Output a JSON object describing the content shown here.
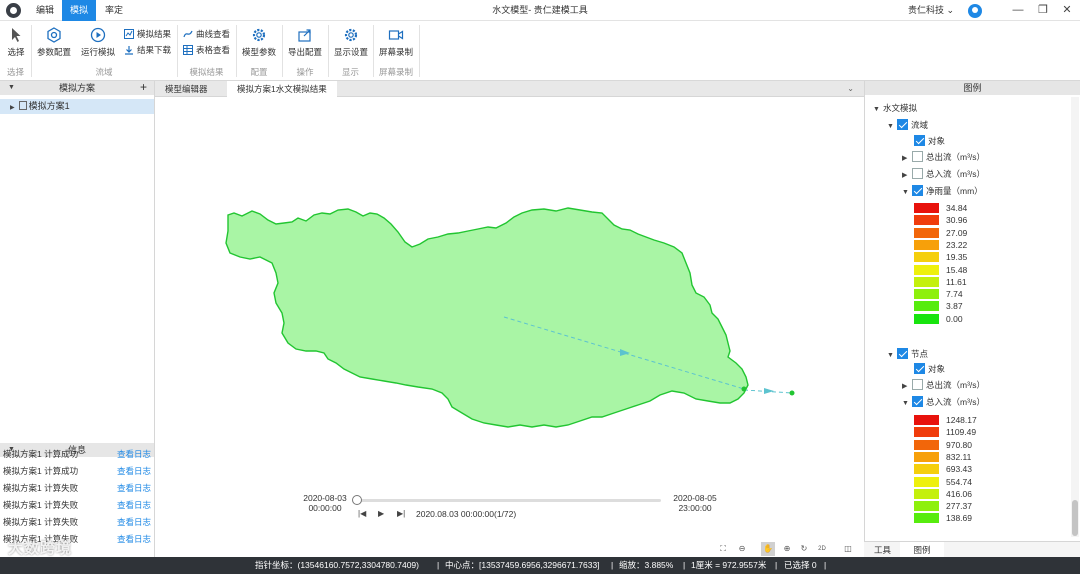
{
  "titlebar": {
    "menu_edit": "编辑",
    "menu_simulate": "模拟",
    "menu_calibrate": "率定",
    "window_title": "水文模型- 贵仁建模工具",
    "company": "贵仁科技 ⌄",
    "accent_color": "#1e88e5"
  },
  "ribbon": {
    "select": "选择",
    "param_config": "参数配置",
    "run_sim": "运行模拟",
    "sim_result": "模拟结果",
    "result_download": "结果下载",
    "curve_view": "曲线查看",
    "table_view": "表格查看",
    "model_params": "模型参数",
    "export_config": "导出配置",
    "display_settings": "显示设置",
    "screen_record": "屏幕录制",
    "groups": {
      "select": "选择",
      "basin": "流域",
      "sim_result": "模拟结果",
      "config": "配置",
      "operation": "操作",
      "display": "显示",
      "screen_record": "屏幕录制"
    }
  },
  "left_panel": {
    "header": "模拟方案",
    "add_icon": "+",
    "tree_item": "模拟方案1",
    "info_header": "信息",
    "info_rows": [
      {
        "msg": "模拟方案1 计算成功",
        "link": "查看日志"
      },
      {
        "msg": "模拟方案1 计算成功",
        "link": "查看日志"
      },
      {
        "msg": "模拟方案1 计算失败",
        "link": "查看日志"
      },
      {
        "msg": "模拟方案1 计算失败",
        "link": "查看日志"
      },
      {
        "msg": "模拟方案1 计算失败",
        "link": "查看日志"
      },
      {
        "msg": "模拟方案1 计算失败",
        "link": "查看日志"
      }
    ]
  },
  "tabs": {
    "tab1": "模型编辑器",
    "tab2": "模拟方案1水文模拟结果"
  },
  "timeline": {
    "start_date": "2020-08-03",
    "start_time": "00:00:00",
    "end_date": "2020-08-05",
    "end_time": "23:00:00",
    "current": "2020.08.03 00:00:00(1/72)",
    "progress": 0
  },
  "map_tools": {
    "mode_2d": "2D"
  },
  "legend_panel": {
    "header": "图例",
    "root": "水文模拟",
    "basin": "流域",
    "object": "对象",
    "total_outflow": "总出流（m³/s）",
    "total_inflow": "总入流（m³/s）",
    "net_rain": "净雨量（mm）",
    "rain_classes": [
      {
        "label": "34.84",
        "color": "#e8120c"
      },
      {
        "label": "30.96",
        "color": "#f03c0c"
      },
      {
        "label": "27.09",
        "color": "#f2660a"
      },
      {
        "label": "23.22",
        "color": "#f7a00a"
      },
      {
        "label": "19.35",
        "color": "#f5cf0c"
      },
      {
        "label": "15.48",
        "color": "#eef00c"
      },
      {
        "label": "11.61",
        "color": "#c4f00c"
      },
      {
        "label": "7.74",
        "color": "#8ef00c"
      },
      {
        "label": "3.87",
        "color": "#57ec0e"
      },
      {
        "label": "0.00",
        "color": "#18e40e"
      }
    ],
    "node": "节点",
    "node_object": "对象",
    "node_total_outflow": "总出流（m³/s）",
    "node_total_inflow": "总入流（m³/s）",
    "inflow_classes": [
      {
        "label": "1248.17",
        "color": "#e8120c"
      },
      {
        "label": "1109.49",
        "color": "#f03c0c"
      },
      {
        "label": "970.80",
        "color": "#f2660a"
      },
      {
        "label": "832.11",
        "color": "#f7a00a"
      },
      {
        "label": "693.43",
        "color": "#f5cf0c"
      },
      {
        "label": "554.74",
        "color": "#eef00c"
      },
      {
        "label": "416.06",
        "color": "#c4f00c"
      },
      {
        "label": "277.37",
        "color": "#8ef00c"
      },
      {
        "label": "138.69",
        "color": "#57ec0e"
      }
    ]
  },
  "bottom_tabs": {
    "tools": "工具",
    "legend": "图例"
  },
  "statusbar": {
    "pointer": "指针坐标：(13546160.7572,3304780.7409)",
    "center": "中心点：[13537459.6956,3296671.7633]",
    "zoom": "缩放：3.885%",
    "scale": "1厘米 = 972.9557米",
    "selected": "已选择 0"
  },
  "watermark": "大数跨境"
}
